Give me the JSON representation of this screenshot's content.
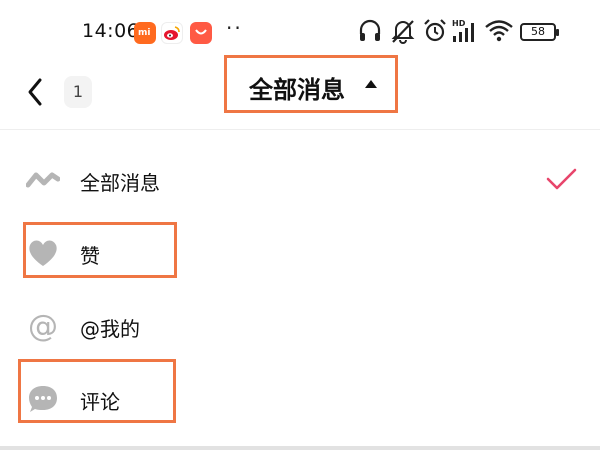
{
  "status_bar": {
    "time": "14:06",
    "mi_mark": "mi",
    "dots": "··",
    "battery": "58",
    "hd_label": "HD"
  },
  "header": {
    "badge_count": "1",
    "title": "全部消息"
  },
  "menu": {
    "items": [
      {
        "label": "全部消息",
        "icon": "wave-icon",
        "selected": true
      },
      {
        "label": "赞",
        "icon": "heart-icon",
        "selected": false
      },
      {
        "label": "@我的",
        "icon": "at-icon",
        "selected": false
      },
      {
        "label": "评论",
        "icon": "comment-bubble-icon",
        "selected": false
      }
    ]
  },
  "colors": {
    "highlight": "#ef7644",
    "check": "#e8456b",
    "icon_gray": "#b5b5b5"
  }
}
